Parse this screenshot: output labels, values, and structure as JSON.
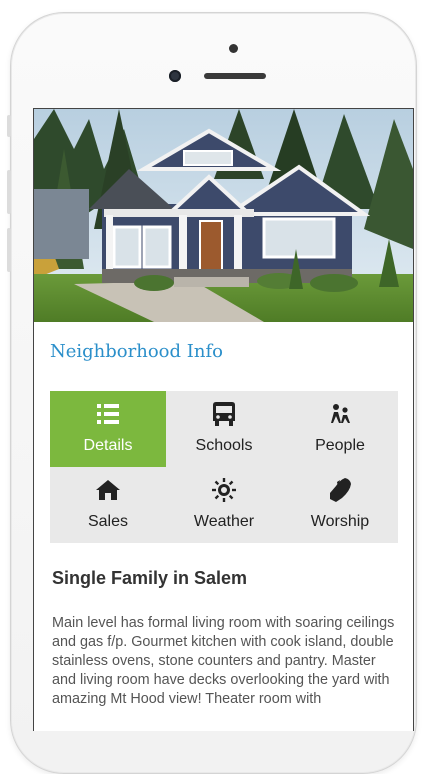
{
  "section": {
    "title": "Neighborhood Info"
  },
  "tabs": [
    {
      "label": "Details",
      "icon": "list-icon",
      "active": true
    },
    {
      "label": "Schools",
      "icon": "bus-icon",
      "active": false
    },
    {
      "label": "People",
      "icon": "people-icon",
      "active": false
    },
    {
      "label": "Sales",
      "icon": "home-icon",
      "active": false
    },
    {
      "label": "Weather",
      "icon": "sun-icon",
      "active": false
    },
    {
      "label": "Worship",
      "icon": "praying-hands-icon",
      "active": false
    }
  ],
  "listing": {
    "title": "Single Family in Salem",
    "description": "Main level has formal living room with soaring ceilings and gas f/p. Gourmet kitchen with cook island, double stainless ovens, stone counters and pantry. Master and living room have decks overlooking the yard with amazing Mt Hood view! Theater room with"
  },
  "colors": {
    "accent": "#2b8fca",
    "active_tab": "#7cb83e",
    "tab_bg": "#e9e9e9"
  }
}
